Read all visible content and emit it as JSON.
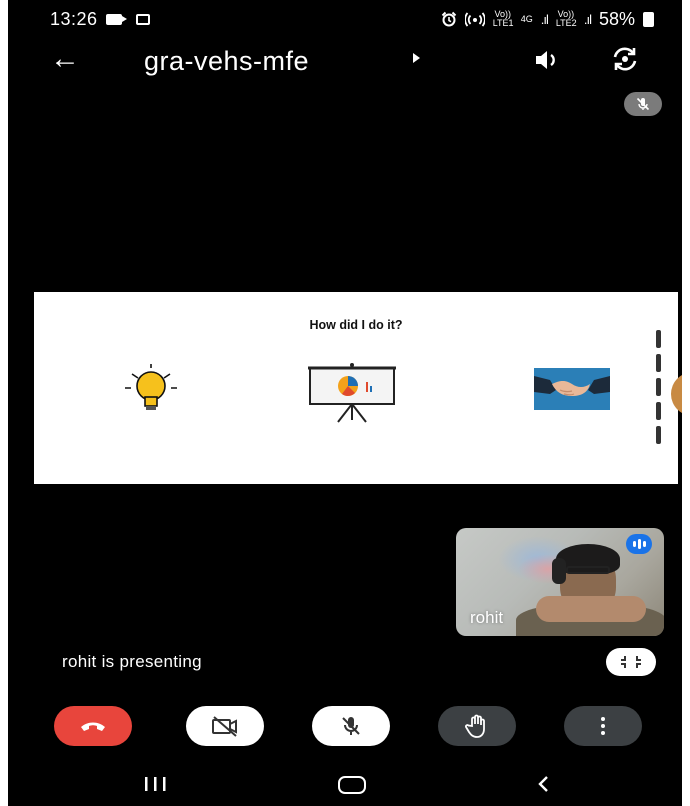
{
  "status_bar": {
    "time": "13:26",
    "network_1": "Vo)) LTE1",
    "network_gen": "4G",
    "signal_1": ".ıl",
    "network_2": "Vo)) LTE2",
    "signal_2": ".ıl",
    "battery_percent": "58%",
    "icons": [
      "video-record-icon",
      "cast-icon",
      "alarm-icon",
      "hotspot-icon",
      "signal-icon",
      "battery-icon"
    ]
  },
  "app_bar": {
    "meeting_code": "gra-vehs-mfe",
    "icons": [
      "back-arrow-icon",
      "dropdown-caret-icon",
      "speaker-icon",
      "switch-camera-icon"
    ]
  },
  "presentation": {
    "slide_heading": "How did I do it?",
    "slide_icons": [
      "lightbulb-icon",
      "presentation-board-icon",
      "handshake-icon"
    ]
  },
  "self_view": {
    "participant_name": "rohit",
    "speaking_indicator": "voice-activity-icon"
  },
  "status": {
    "presenting_text": "rohit is presenting"
  },
  "controls": {
    "items": [
      {
        "name": "end-call",
        "icon": "phone-hangup-icon",
        "color": "#e8453c"
      },
      {
        "name": "camera-off",
        "icon": "video-off-icon",
        "color": "#ffffff"
      },
      {
        "name": "mic-off",
        "icon": "mic-off-icon",
        "color": "#ffffff"
      },
      {
        "name": "raise-hand",
        "icon": "hand-icon",
        "color": "#3c4043"
      },
      {
        "name": "more-options",
        "icon": "more-vert-icon",
        "color": "#3c4043"
      }
    ]
  },
  "nav_bar": {
    "icons": [
      "recents-icon",
      "home-icon",
      "back-icon"
    ]
  },
  "colors": {
    "background": "#000000",
    "end_call_red": "#e8453c",
    "dark_button": "#3c4043",
    "speaking_blue": "#1a73e8",
    "bulb_yellow": "#f6c11c"
  }
}
